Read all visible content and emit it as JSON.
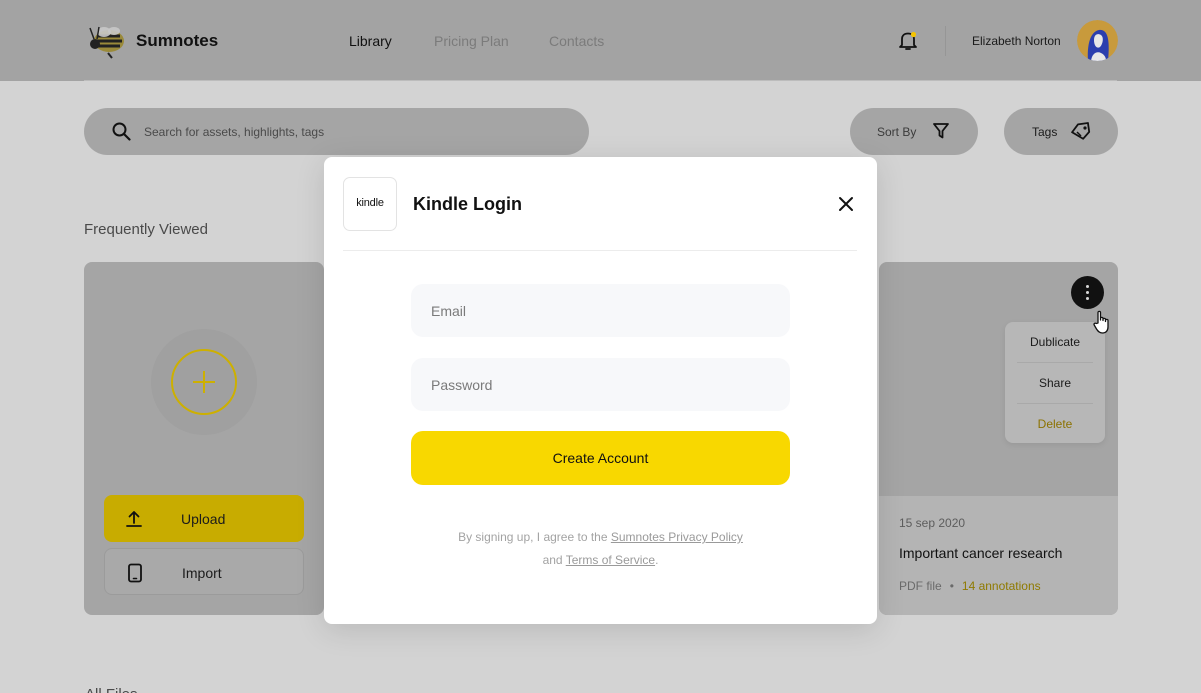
{
  "header": {
    "brand": "Sumnotes",
    "nav": [
      "Library",
      "Pricing Plan",
      "Contacts"
    ],
    "active_nav": "Library",
    "user_name": "Elizabeth Norton",
    "icons": {
      "logo": "bee-logo",
      "notifications": "bell-icon",
      "avatar": "user-avatar"
    },
    "notification_dot_color": "#f5c400"
  },
  "toolbar": {
    "search_placeholder": "Search for assets, highlights, tags",
    "sort_label": "Sort By",
    "tags_label": "Tags",
    "icons": {
      "search": "search-icon",
      "sort": "filter-icon",
      "tags": "tag-icon"
    }
  },
  "sections": {
    "frequently_viewed": "Frequently Viewed",
    "all_files": "All Files"
  },
  "left_card": {
    "upload_label": "Upload",
    "import_label": "Import",
    "icons": {
      "add": "plus-circle-icon",
      "upload": "upload-icon",
      "import": "tablet-icon"
    }
  },
  "right_card": {
    "date": "15 sep 2020",
    "title": "Important cancer research",
    "file_type": "PDF file",
    "separator": "•",
    "annotations": "14 annotations",
    "menu": [
      "Dublicate",
      "Share",
      "Delete"
    ],
    "icons": {
      "menu": "more-vertical-icon",
      "cursor": "hand-pointer-icon"
    }
  },
  "modal": {
    "logo_text": "kindle",
    "title": "Kindle Login",
    "email_placeholder": "Email",
    "password_placeholder": "Password",
    "submit_label": "Create Account",
    "legal_prefix": "By signing up, I agree to the",
    "privacy_link": "Sumnotes Privacy Policy",
    "legal_and": "and",
    "terms_link": "Terms of Service",
    "legal_suffix": ".",
    "icons": {
      "close": "close-icon"
    }
  },
  "colors": {
    "accent_yellow": "#f8d800",
    "overlay_gray": "#a5a5a5",
    "delete_text": "#8c7200"
  }
}
